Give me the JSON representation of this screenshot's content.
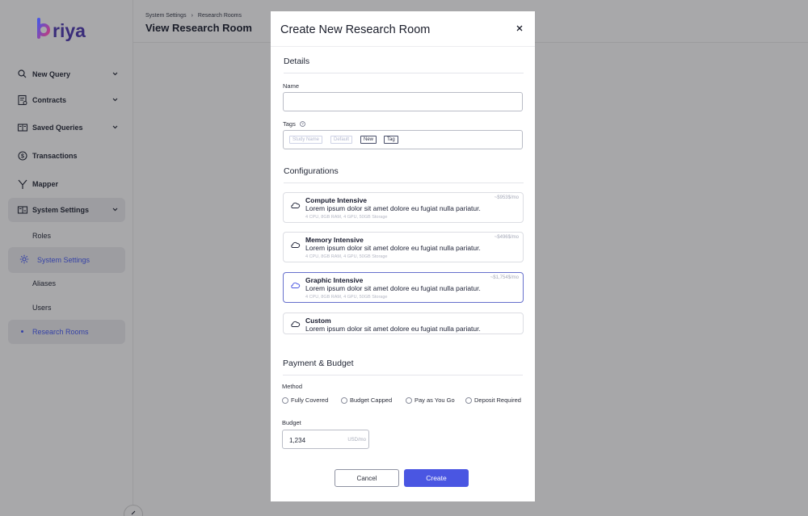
{
  "brand": {
    "name": "briya",
    "color_start": "#4a56e2",
    "color_end": "#c43a7a",
    "text_color": "#3a2d7a"
  },
  "sidebar": {
    "items": [
      {
        "label": "New Query",
        "icon": "search-icon",
        "has_chevron": true
      },
      {
        "label": "Contracts",
        "icon": "contract-icon",
        "has_chevron": true
      },
      {
        "label": "Saved Queries",
        "icon": "book-icon",
        "has_chevron": true
      },
      {
        "label": "Transactions",
        "icon": "dollar-icon",
        "has_chevron": false
      },
      {
        "label": "Mapper",
        "icon": "mapper-icon",
        "has_chevron": false
      },
      {
        "label": "System Settings",
        "icon": "settings-panel-icon",
        "has_chevron": true,
        "expanded": true
      }
    ],
    "sub_items": [
      {
        "label": "Roles"
      },
      {
        "label": "System Settings",
        "icon": "gear-icon",
        "highlighted": true
      },
      {
        "label": "Aliases"
      },
      {
        "label": "Users"
      },
      {
        "label": "Research Rooms",
        "current": true
      }
    ]
  },
  "header": {
    "breadcrumbs": [
      "System Settings",
      "Research Rooms"
    ],
    "title": "View Research Room"
  },
  "modal": {
    "title": "Create New Research Room",
    "details": {
      "section_title": "Details",
      "name_label": "Name",
      "name_value": "",
      "tags_label": "Tags",
      "tag_placeholders": [
        "Study Name",
        "Default"
      ],
      "tags": [
        "New",
        "Tag"
      ]
    },
    "configurations": {
      "section_title": "Configurations",
      "options": [
        {
          "name": "Compute Intensive",
          "description": "Lorem ipsum dolor sit amet dolore eu fugiat nulla pariatur.",
          "specs": "4 CPU, 8GB RAM, 4 GPU, 50GB Storage",
          "price": "~$953$/mo",
          "selected": false
        },
        {
          "name": "Memory Intensive",
          "description": "Lorem ipsum dolor sit amet dolore eu fugiat nulla pariatur.",
          "specs": "4 CPU, 8GB RAM, 4 GPU, 50GB Storage",
          "price": "~$496$/mo",
          "selected": false
        },
        {
          "name": "Graphic Intensive",
          "description": "Lorem ipsum dolor sit amet dolore eu fugiat nulla pariatur.",
          "specs": "4 CPU, 8GB RAM, 4 GPU, 50GB Storage",
          "price": "~$1,754$/mo",
          "selected": true
        },
        {
          "name": "Custom",
          "description": "Lorem ipsum dolor sit amet dolore eu fugiat nulla pariatur.",
          "specs": "",
          "price": "",
          "selected": false
        }
      ]
    },
    "payment": {
      "section_title": "Payment & Budget",
      "method_label": "Method",
      "methods": [
        "Fully Covered",
        "Budget Capped",
        "Pay as You Go",
        "Deposit Required"
      ],
      "budget_label": "Budget",
      "budget_value": "1,234",
      "budget_unit": "USD/mo"
    },
    "cancel_label": "Cancel",
    "create_label": "Create"
  },
  "colors": {
    "accent": "#4a56e2",
    "overlay": "#a7a7a9",
    "selected_border": "#6670cc"
  }
}
